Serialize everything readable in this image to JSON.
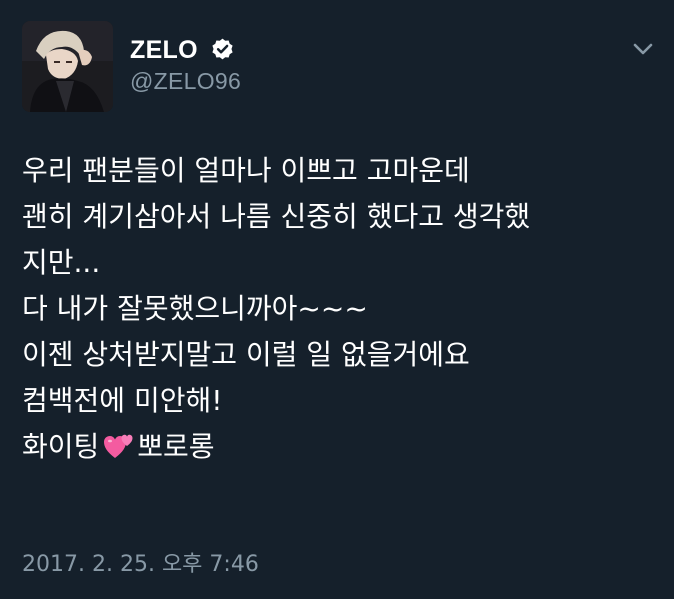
{
  "user": {
    "display_name": "ZELO",
    "handle": "@ZELO96",
    "verified": true
  },
  "icons": {
    "verified": "verified-badge-icon",
    "menu": "chevron-down-icon",
    "emoji": "two-hearts-emoji-icon"
  },
  "tweet": {
    "lines": [
      "우리 팬분들이 얼마나 이쁘고 고마운데",
      "괜히 계기삼아서 나름 신중히 했다고 생각했",
      "지만...",
      "다 내가 잘못했으니까아~~~",
      "이젠 상처받지말고 이럴 일 없을거에요",
      "컴백전에 미안해!"
    ],
    "last_line_before_emoji": "화이팅",
    "last_line_after_emoji": "뽀로롱"
  },
  "timestamp": "2017. 2. 25. 오후 7:46",
  "colors": {
    "background": "#15202b",
    "primary_text": "#ffffff",
    "secondary_text": "#8899a6",
    "emoji_pink": "#f45ba0"
  }
}
